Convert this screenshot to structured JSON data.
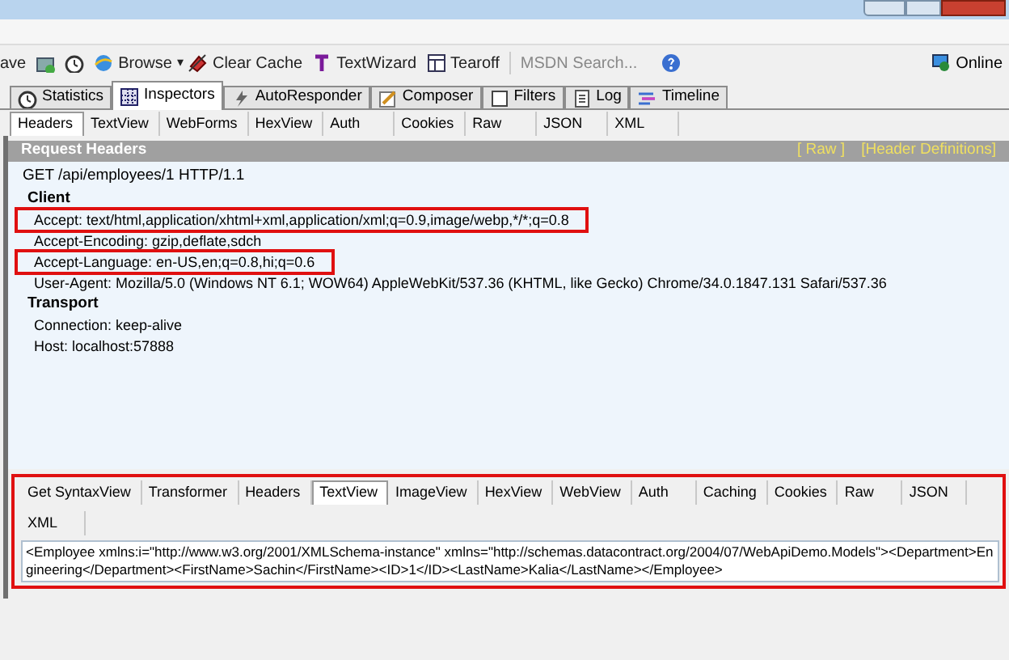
{
  "toolbar": {
    "items": [
      {
        "kind": "text",
        "label": "ave"
      },
      {
        "kind": "icon"
      },
      {
        "kind": "icon"
      },
      {
        "kind": "text",
        "label": "Browse"
      },
      {
        "kind": "caret",
        "label": "▾"
      },
      {
        "kind": "text",
        "label": "Clear Cache"
      },
      {
        "kind": "text",
        "label": "TextWizard"
      },
      {
        "kind": "text",
        "label": "Tearoff"
      },
      {
        "kind": "search",
        "placeholder": "MSDN Search..."
      },
      {
        "kind": "icon"
      }
    ],
    "online": "Online"
  },
  "main_tabs": [
    {
      "label": "Statistics",
      "selected": false
    },
    {
      "label": "Inspectors",
      "selected": true
    },
    {
      "label": "AutoResponder",
      "selected": false
    },
    {
      "label": "Composer",
      "selected": false
    },
    {
      "label": "Filters",
      "selected": false
    },
    {
      "label": "Log",
      "selected": false
    },
    {
      "label": "Timeline",
      "selected": false
    }
  ],
  "request_tabs": [
    {
      "label": "Headers",
      "selected": true
    },
    {
      "label": "TextView",
      "selected": false
    },
    {
      "label": "WebForms",
      "selected": false
    },
    {
      "label": "HexView",
      "selected": false
    },
    {
      "label": "Auth",
      "selected": false
    },
    {
      "label": "Cookies",
      "selected": false
    },
    {
      "label": "Raw",
      "selected": false
    },
    {
      "label": "JSON",
      "selected": false
    },
    {
      "label": "XML",
      "selected": false
    }
  ],
  "request_headers": {
    "title": "Request Headers",
    "links": [
      "[ Raw ]",
      "[Header Definitions]"
    ],
    "request_line": "GET /api/employees/1 HTTP/1.1",
    "groups": [
      {
        "name": "Client",
        "headers": [
          {
            "text": "Accept: text/html,application/xhtml+xml,application/xml;q=0.9,image/webp,*/*;q=0.8",
            "highlighted": true
          },
          {
            "text": "Accept-Encoding: gzip,deflate,sdch",
            "highlighted": false
          },
          {
            "text": "Accept-Language: en-US,en;q=0.8,hi;q=0.6",
            "highlighted": true
          },
          {
            "text": "User-Agent: Mozilla/5.0 (Windows NT 6.1; WOW64) AppleWebKit/537.36 (KHTML, like Gecko) Chrome/34.0.1847.131 Safari/537.36",
            "highlighted": false
          }
        ]
      },
      {
        "name": "Transport",
        "headers": [
          {
            "text": "Connection: keep-alive",
            "highlighted": false
          },
          {
            "text": "Host: localhost:57888",
            "highlighted": false
          }
        ]
      }
    ]
  },
  "response": {
    "highlighted": true,
    "tabs": [
      {
        "label": "Get SyntaxView",
        "selected": false
      },
      {
        "label": "Transformer",
        "selected": false
      },
      {
        "label": "Headers",
        "selected": false
      },
      {
        "label": "TextView",
        "selected": true
      },
      {
        "label": "ImageView",
        "selected": false
      },
      {
        "label": "HexView",
        "selected": false
      },
      {
        "label": "WebView",
        "selected": false
      },
      {
        "label": "Auth",
        "selected": false
      },
      {
        "label": "Caching",
        "selected": false
      },
      {
        "label": "Cookies",
        "selected": false
      },
      {
        "label": "Raw",
        "selected": false
      },
      {
        "label": "JSON",
        "selected": false
      },
      {
        "label": "XML",
        "selected": false
      }
    ],
    "body": "<Employee xmlns:i=\"http://www.w3.org/2001/XMLSchema-instance\" xmlns=\"http://schemas.datacontract.org/2004/07/WebApiDemo.Models\"><Department>Engineering</Department><FirstName>Sachin</FirstName><ID>1</ID><LastName>Kalia</LastName></Employee>"
  }
}
